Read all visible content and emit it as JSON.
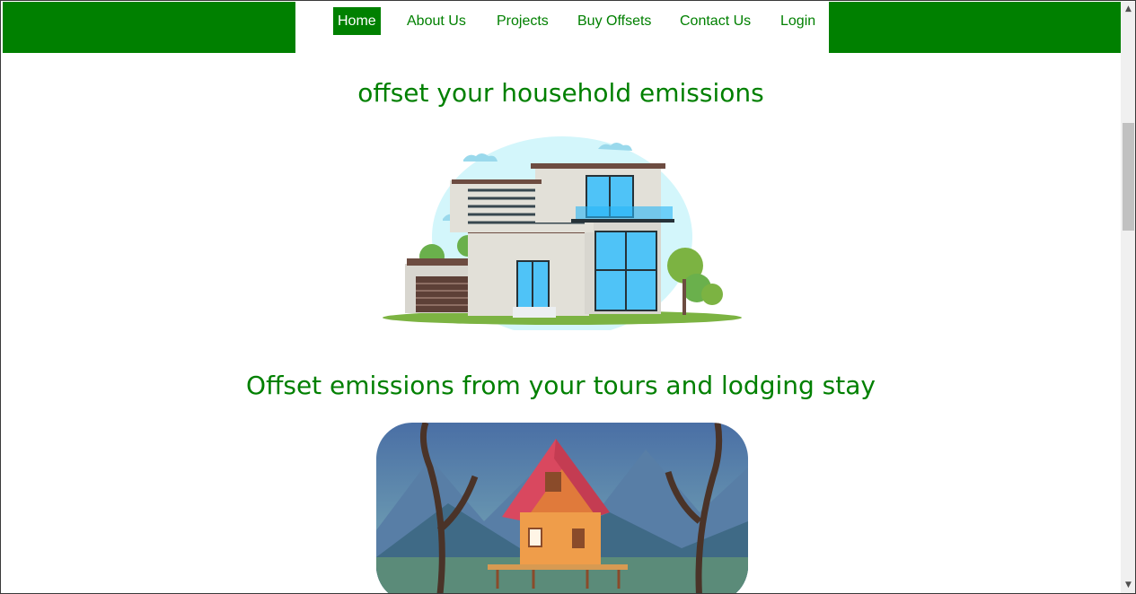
{
  "nav": {
    "items": [
      {
        "label": "Home",
        "active": true
      },
      {
        "label": "About Us",
        "active": false
      },
      {
        "label": "Projects",
        "active": false
      },
      {
        "label": "Buy Offsets",
        "active": false
      },
      {
        "label": "Contact Us",
        "active": false
      },
      {
        "label": "Login",
        "active": false
      }
    ]
  },
  "sections": {
    "household": {
      "heading": "offset your household emissions"
    },
    "tours": {
      "heading": "Offset emissions from your tours and lodging stay"
    }
  },
  "colors": {
    "brand": "#008000",
    "background": "#ffffff"
  },
  "icons": {
    "scroll_up": "chevron-up-icon",
    "scroll_down": "chevron-down-icon"
  }
}
